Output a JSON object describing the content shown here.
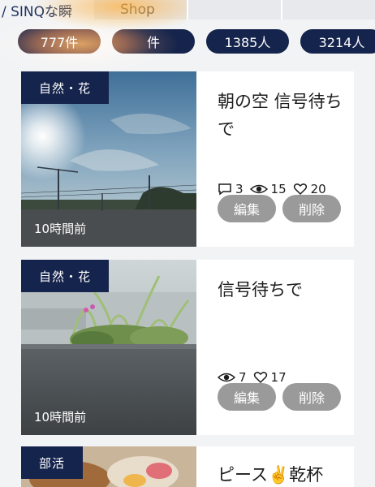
{
  "tabs": [
    "/ SINQな瞬",
    "Shop",
    "",
    ""
  ],
  "chips": [
    "777件",
    "件",
    "1385人",
    "3214人"
  ],
  "colors": {
    "navy": "#15244c",
    "button_gray": "#9a9a9a"
  },
  "posts": [
    {
      "category": "自然・花",
      "time_ago": "10時間前",
      "title": "朝の空 信号待ちで",
      "comments": "3",
      "views": "15",
      "likes": "20",
      "edit_label": "編集",
      "delete_label": "削除"
    },
    {
      "category": "自然・花",
      "time_ago": "10時間前",
      "title": "信号待ちで",
      "views": "7",
      "likes": "17",
      "edit_label": "編集",
      "delete_label": "削除"
    },
    {
      "category": "部活",
      "title": "ピース✌️乾杯"
    }
  ]
}
